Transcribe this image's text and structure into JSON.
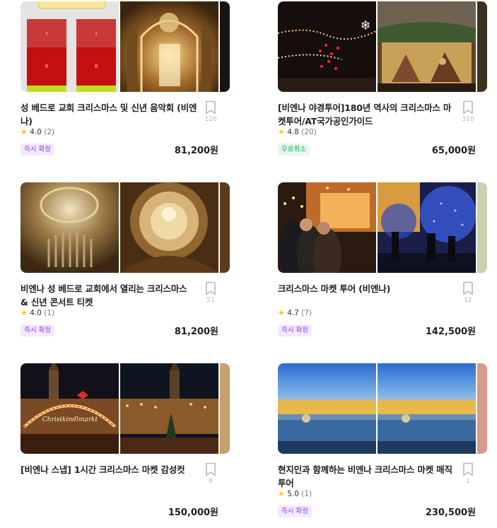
{
  "cards": [
    {
      "title": "성 베드로 교회 크리스마스 및 신년 음악회 (비엔나)",
      "rating": "4.0",
      "reviews": "(2)",
      "badge": "즉시 확정",
      "price": "81,200원",
      "saves": "126"
    },
    {
      "title": "[비엔나 야경투어]180년 역사의 크리스마스 마켓투어/AT국가공인가이드",
      "rating": "4.8",
      "reviews": "(20)",
      "badge": "무료취소",
      "price": "65,000원",
      "saves": "310"
    },
    {
      "title": "비엔나 성 베드로 교회에서 열리는 크리스마스 & 신년 콘서트 티켓",
      "rating": "4.0",
      "reviews": "(1)",
      "badge": "즉시 확정",
      "price": "81,200원",
      "saves": "51"
    },
    {
      "title": "크리스마스 마켓 투어 (비엔나)",
      "rating": "4.7",
      "reviews": "(7)",
      "badge": "즉시 확정",
      "price": "142,500원",
      "saves": "12"
    },
    {
      "title": "[비엔나 스냅] 1시간 크리스마스 마켓 감성컷",
      "rating": "",
      "reviews": "",
      "badge": "",
      "price": "150,000원",
      "saves": "8"
    },
    {
      "title": "현지인과 함께하는 비엔나 크리스마스 마켓 매직 투어",
      "rating": "5.0",
      "reviews": "(1)",
      "badge": "즉시 확정",
      "price": "230,500원",
      "saves": "1"
    }
  ],
  "colors": {
    "badge_purple": "#8a3ff0",
    "badge_green": "#17a858",
    "star": "#ffc61a"
  },
  "icons": {
    "bookmark": "bookmark-icon",
    "star": "star-icon"
  }
}
